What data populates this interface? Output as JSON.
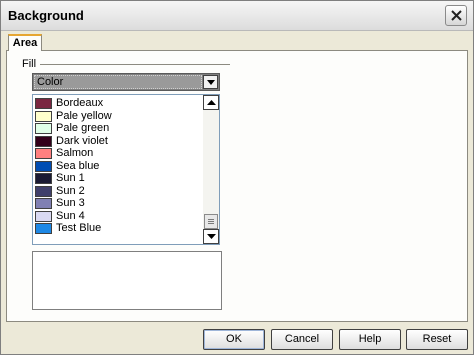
{
  "window": {
    "title": "Background"
  },
  "tabs": [
    {
      "label": "Area",
      "selected": true
    }
  ],
  "fill": {
    "group_label": "Fill",
    "type_select": {
      "value": "Color"
    },
    "colors": [
      {
        "name": "Bordeaux",
        "color": "#7a2741"
      },
      {
        "name": "Pale yellow",
        "color": "#ffffcc"
      },
      {
        "name": "Pale green",
        "color": "#e0ffe8"
      },
      {
        "name": "Dark violet",
        "color": "#33001a"
      },
      {
        "name": "Salmon",
        "color": "#ff8080"
      },
      {
        "name": "Sea blue",
        "color": "#004db3"
      },
      {
        "name": "Sun 1",
        "color": "#1a1a33"
      },
      {
        "name": "Sun 2",
        "color": "#40406b"
      },
      {
        "name": "Sun 3",
        "color": "#8080b3"
      },
      {
        "name": "Sun 4",
        "color": "#d9d9f2"
      },
      {
        "name": "Test Blue",
        "color": "#1e88e5"
      }
    ]
  },
  "buttons": {
    "ok": "OK",
    "cancel": "Cancel",
    "help": "Help",
    "reset": "Reset"
  }
}
